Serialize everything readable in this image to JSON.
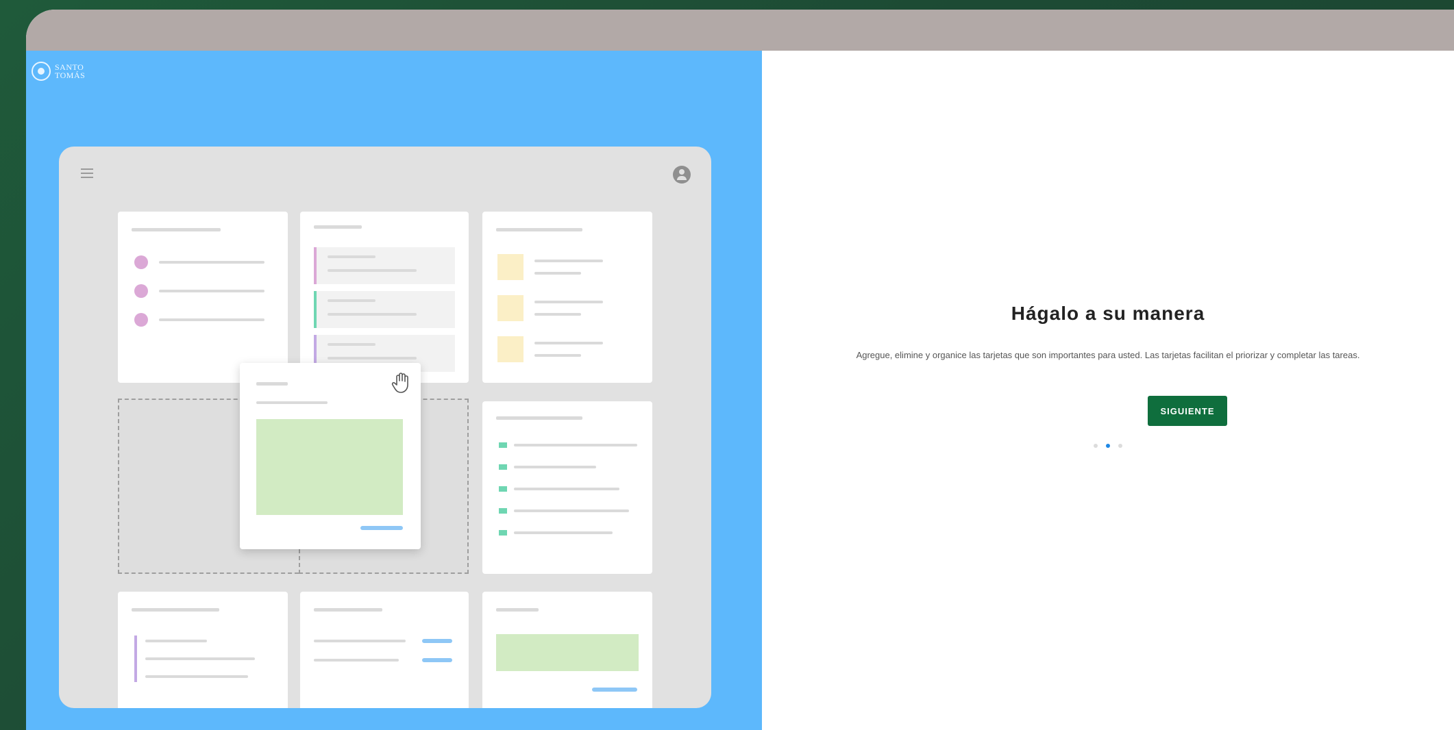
{
  "logo": {
    "text": "SANTO TOMÁS"
  },
  "onboarding": {
    "title": "Hágalo a su manera",
    "description": "Agregue, elimine y organice las tarjetas que son importantes para usted. Las tarjetas facilitan el priorizar y completar las tareas.",
    "next_label": "SIGUIENTE",
    "page_count": 3,
    "active_page": 2
  },
  "illustration": {
    "menu_icon": "hamburger-menu-icon",
    "avatar_icon": "user-avatar-icon",
    "drag_icon": "grab-hand-icon"
  },
  "colors": {
    "background": "#1d4a34",
    "topbar": "#b2a9a7",
    "left_panel": "#5db8fc",
    "button": "#0f6e3d",
    "active_dot": "#1e88e5"
  }
}
